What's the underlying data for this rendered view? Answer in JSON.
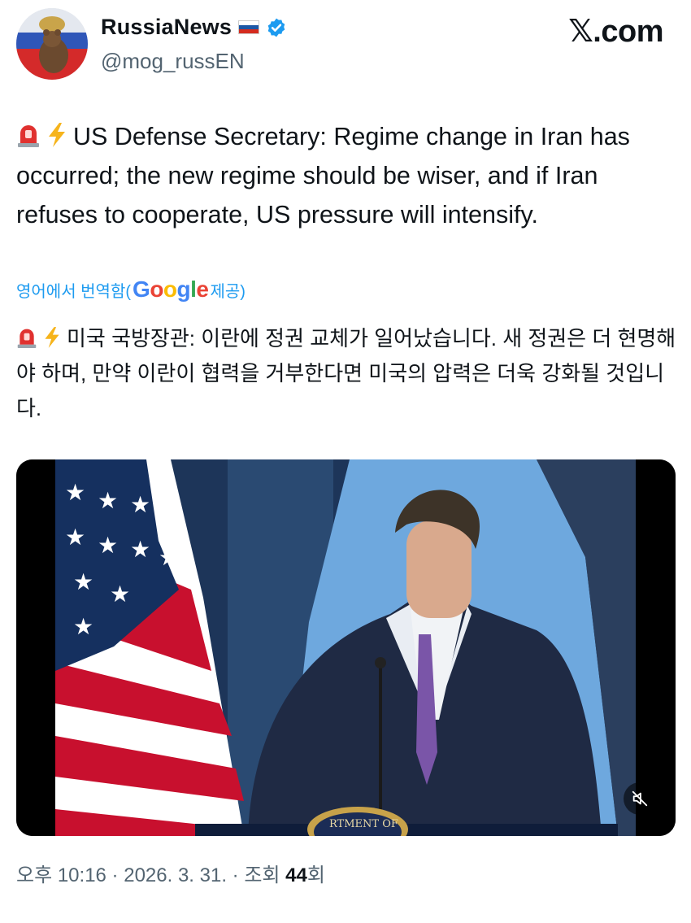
{
  "author": {
    "display_name": "RussiaNews",
    "handle": "@mog_russEN",
    "flag_icon": "russia-flag-icon",
    "verified": true
  },
  "site_label": "𝕏.com",
  "tweet": {
    "text": "US Defense Secretary: Regime change in Iran has occurred; the new regime should be wiser, and if Iran refuses to cooperate, US pressure will intensify.",
    "leading_icons": [
      "rotating-light-icon",
      "lightning-icon"
    ]
  },
  "translation": {
    "prefix": "영어에서 번역함(",
    "provider": "Google",
    "suffix": " 제공)",
    "text": "미국 국방장관: 이란에 정권 교체가 일어났습니다. 새 정권은 더 현명해야 하며, 만약 이란이 협력을 거부한다면 미국의 압력은 더욱 강화될 것입니다."
  },
  "media": {
    "type": "video",
    "seal_text": "RTMENT OF",
    "mute_icon": "muted-speaker-icon"
  },
  "meta": {
    "time": "오후 10:16",
    "separator": " · ",
    "date": "2026. 3. 31.",
    "views_prefix": "조회 ",
    "views_count": "44",
    "views_suffix": "회"
  },
  "colors": {
    "link_blue": "#1d9bf0",
    "secondary_text": "#536471",
    "primary_text": "#0f1419",
    "verified_blue": "#1d9bf0"
  }
}
